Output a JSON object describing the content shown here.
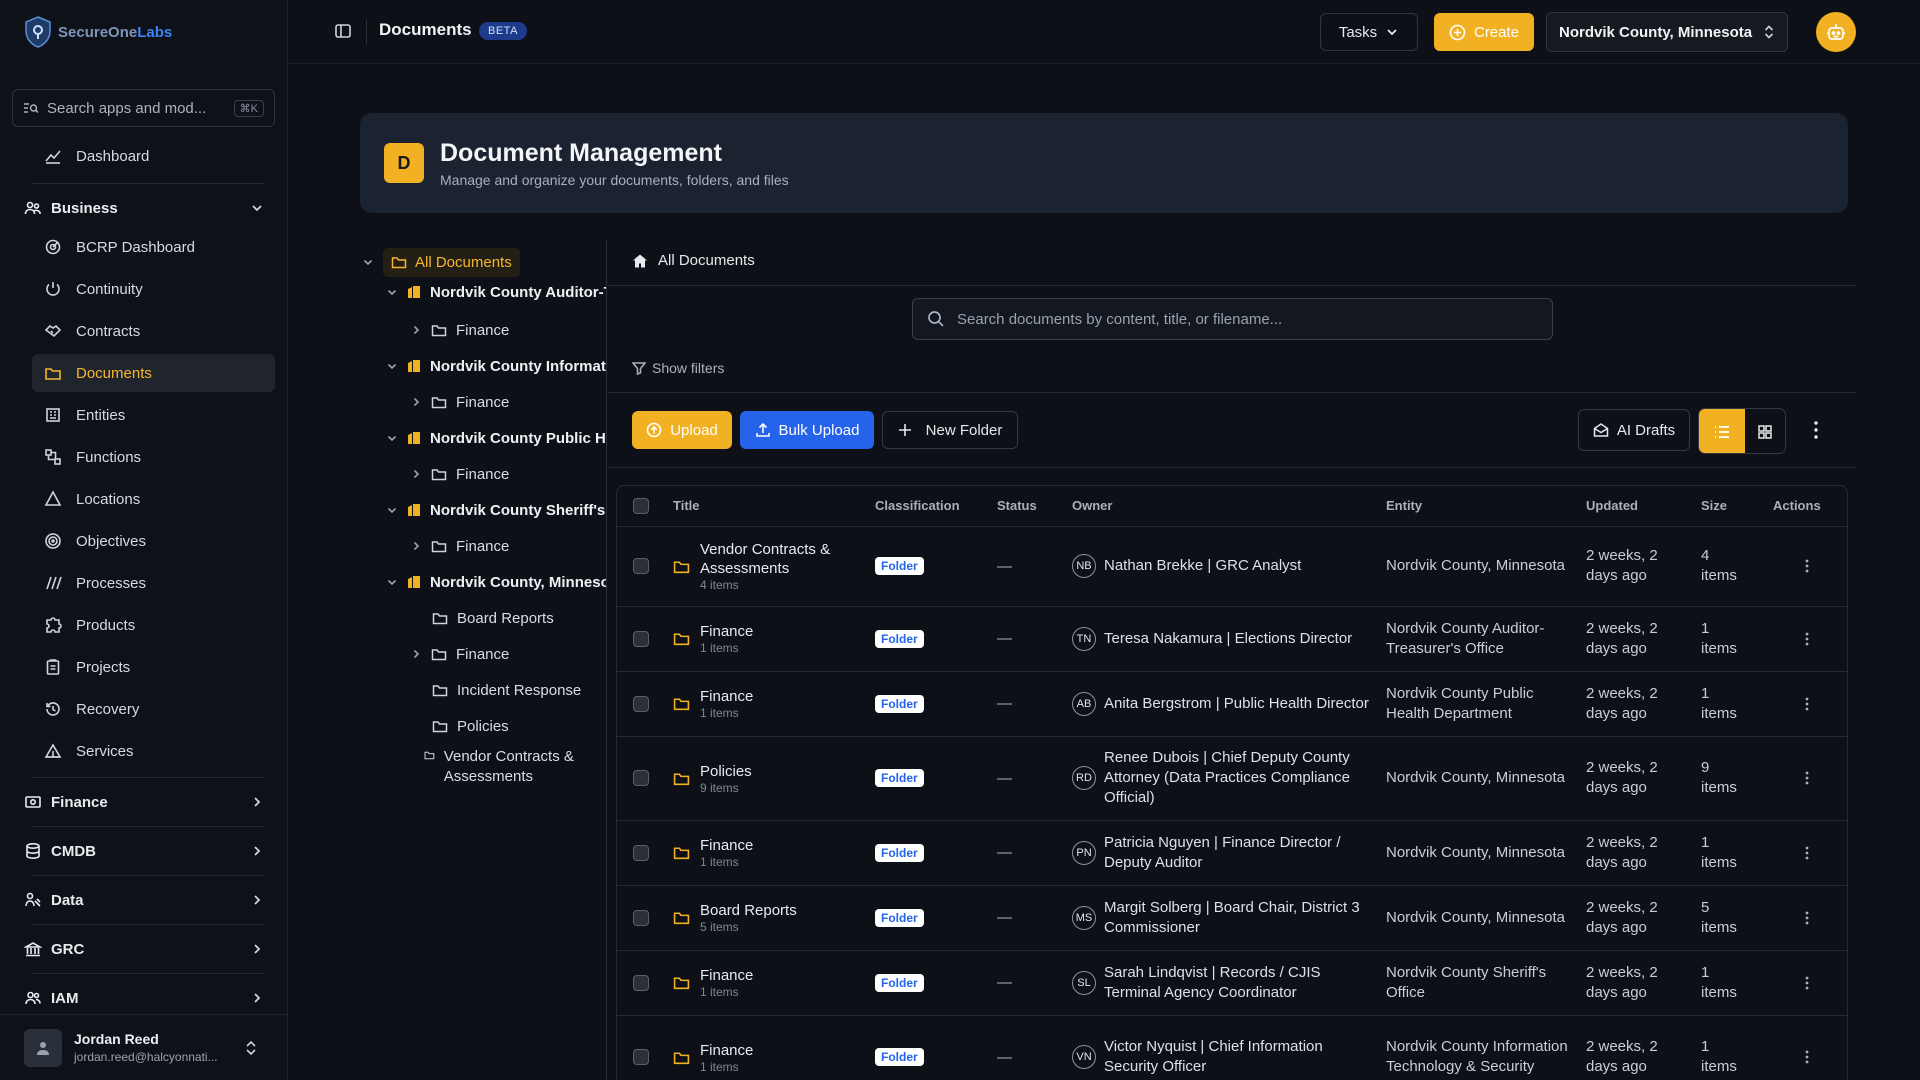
{
  "app": {
    "brand_a": "SecureOne",
    "brand_b": "Labs"
  },
  "search": {
    "placeholder": "Search apps and mod...",
    "shortcut": "⌘K"
  },
  "nav": {
    "dashboard": "Dashboard",
    "business_group": "Business",
    "business_items": [
      {
        "label": "BCRP Dashboard",
        "icon": "radar-icon"
      },
      {
        "label": "Continuity",
        "icon": "power-icon"
      },
      {
        "label": "Contracts",
        "icon": "handshake-icon"
      },
      {
        "label": "Documents",
        "icon": "folder-icon",
        "active": true
      },
      {
        "label": "Entities",
        "icon": "building-icon"
      },
      {
        "label": "Functions",
        "icon": "network-icon"
      },
      {
        "label": "Locations",
        "icon": "triangle-icon"
      },
      {
        "label": "Objectives",
        "icon": "target-icon"
      },
      {
        "label": "Processes",
        "icon": "slashes-icon"
      },
      {
        "label": "Products",
        "icon": "puzzle-icon"
      },
      {
        "label": "Projects",
        "icon": "clipboard-icon"
      },
      {
        "label": "Recovery",
        "icon": "history-icon"
      },
      {
        "label": "Services",
        "icon": "tent-icon"
      }
    ],
    "groups": [
      {
        "label": "Finance",
        "icon": "money-icon"
      },
      {
        "label": "CMDB",
        "icon": "database-icon"
      },
      {
        "label": "Data",
        "icon": "data-icon"
      },
      {
        "label": "GRC",
        "icon": "landmark-icon"
      },
      {
        "label": "IAM",
        "icon": "users-icon"
      }
    ]
  },
  "user": {
    "name": "Jordan Reed",
    "email": "jordan.reed@halcyonnati..."
  },
  "topbar": {
    "title": "Documents",
    "beta": "BETA",
    "tasks": "Tasks",
    "create": "Create",
    "org": "Nordvik County, Minnesota"
  },
  "hero": {
    "badge": "D",
    "title": "Document Management",
    "subtitle": "Manage and organize your documents, folders, and files"
  },
  "tree": [
    {
      "label": "All Documents",
      "level": 0,
      "kind": "root",
      "selected": true
    },
    {
      "label": "Nordvik County Auditor-Treasurer's Office",
      "level": 1,
      "kind": "entity"
    },
    {
      "label": "Finance",
      "level": 2,
      "kind": "folder",
      "expandable": true
    },
    {
      "label": "Nordvik County Information Technology & Security",
      "level": 1,
      "kind": "entity"
    },
    {
      "label": "Finance",
      "level": 2,
      "kind": "folder",
      "expandable": true
    },
    {
      "label": "Nordvik County Public Health Department",
      "level": 1,
      "kind": "entity"
    },
    {
      "label": "Finance",
      "level": 2,
      "kind": "folder",
      "expandable": true
    },
    {
      "label": "Nordvik County Sheriff's Office",
      "level": 1,
      "kind": "entity"
    },
    {
      "label": "Finance",
      "level": 2,
      "kind": "folder",
      "expandable": true
    },
    {
      "label": "Nordvik County, Minnesota",
      "level": 1,
      "kind": "entity"
    },
    {
      "label": "Board Reports",
      "level": 2,
      "kind": "folder",
      "expandable": false
    },
    {
      "label": "Finance",
      "level": 2,
      "kind": "folder",
      "expandable": true
    },
    {
      "label": "Incident Response",
      "level": 2,
      "kind": "folder",
      "expandable": false
    },
    {
      "label": "Policies",
      "level": 2,
      "kind": "folder",
      "expandable": false
    },
    {
      "label": "Vendor Contracts & Assessments",
      "level": 2,
      "kind": "folder",
      "expandable": false
    }
  ],
  "panel": {
    "breadcrumb": "All Documents",
    "search_placeholder": "Search documents by content, title, or filename...",
    "filters": "Show filters",
    "upload": "Upload",
    "bulk_upload": "Bulk Upload",
    "new_folder": "New Folder",
    "ai_drafts": "AI Drafts"
  },
  "table": {
    "headers": [
      "Title",
      "Classification",
      "Status",
      "Owner",
      "Entity",
      "Updated",
      "Size",
      "Actions"
    ],
    "rows": [
      {
        "title": "Vendor Contracts & Assessments",
        "count": "4 items",
        "class": "Folder",
        "status": "—",
        "initials": "NB",
        "owner": "Nathan Brekke | GRC Analyst",
        "entity": "Nordvik County, Minnesota",
        "updated": "2 weeks, 2 days ago",
        "size": "4 items"
      },
      {
        "title": "Finance",
        "count": "1 items",
        "class": "Folder",
        "status": "—",
        "initials": "TN",
        "owner": "Teresa Nakamura | Elections Director",
        "entity": "Nordvik County Auditor-Treasurer's Office",
        "updated": "2 weeks, 2 days ago",
        "size": "1 items"
      },
      {
        "title": "Finance",
        "count": "1 items",
        "class": "Folder",
        "status": "—",
        "initials": "AB",
        "owner": "Anita Bergstrom | Public Health Director",
        "entity": "Nordvik County Public Health Department",
        "updated": "2 weeks, 2 days ago",
        "size": "1 items"
      },
      {
        "title": "Policies",
        "count": "9 items",
        "class": "Folder",
        "status": "—",
        "initials": "RD",
        "owner": "Renee Dubois | Chief Deputy County Attorney (Data Practices Compliance Official)",
        "entity": "Nordvik County, Minnesota",
        "updated": "2 weeks, 2 days ago",
        "size": "9 items"
      },
      {
        "title": "Finance",
        "count": "1 items",
        "class": "Folder",
        "status": "—",
        "initials": "PN",
        "owner": "Patricia Nguyen | Finance Director / Deputy Auditor",
        "entity": "Nordvik County, Minnesota",
        "updated": "2 weeks, 2 days ago",
        "size": "1 items"
      },
      {
        "title": "Board Reports",
        "count": "5 items",
        "class": "Folder",
        "status": "—",
        "initials": "MS",
        "owner": "Margit Solberg | Board Chair, District 3 Commissioner",
        "entity": "Nordvik County, Minnesota",
        "updated": "2 weeks, 2 days ago",
        "size": "5 items"
      },
      {
        "title": "Finance",
        "count": "1 items",
        "class": "Folder",
        "status": "—",
        "initials": "SL",
        "owner": "Sarah Lindqvist | Records / CJIS Terminal Agency Coordinator",
        "entity": "Nordvik County Sheriff's Office",
        "updated": "2 weeks, 2 days ago",
        "size": "1 items"
      },
      {
        "title": "Finance",
        "count": "1 items",
        "class": "Folder",
        "status": "—",
        "initials": "VN",
        "owner": "Victor Nyquist | Chief Information Security Officer",
        "entity": "Nordvik County Information Technology & Security",
        "updated": "2 weeks, 2 days ago",
        "size": "1 items"
      }
    ]
  },
  "colors": {
    "accent": "#f2b122",
    "primary": "#2563eb",
    "bg": "#0d1117"
  }
}
